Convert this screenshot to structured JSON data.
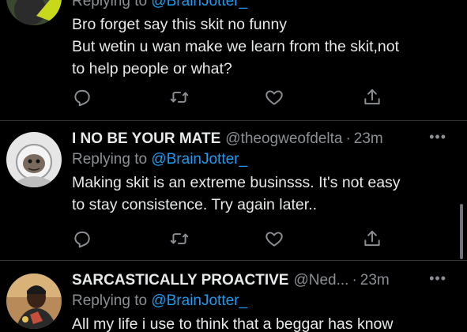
{
  "tweets": [
    {
      "replying_prefix": "Replying to",
      "replying_handle": "@BrainJotter_",
      "lines": [
        "Bro forget say this skit no funny",
        "But wetin u wan make we learn from the skit,not",
        "to help people or what?"
      ]
    },
    {
      "name": "I NO BE YOUR MATE",
      "handle": "@theogweofdelta",
      "dot": "·",
      "time": "23m",
      "more": "•••",
      "replying_prefix": "Replying to",
      "replying_handle": "@BrainJotter_",
      "lines": [
        "Making skit is an extreme businsss. It's not easy",
        "to stay consistence. Try again later.."
      ]
    },
    {
      "name": "SARCASTICALLY PROACTIVE",
      "handle": "@Ned...",
      "dot": "·",
      "time": "23m",
      "more": "•••",
      "replying_prefix": "Replying to",
      "replying_handle": "@BrainJotter_",
      "lines": [
        "All my life i use to think that a beggar has know"
      ]
    }
  ],
  "icons": {
    "reply": "reply-icon",
    "retweet": "retweet-icon",
    "like": "like-icon",
    "share": "share-icon",
    "more": "more-icon"
  },
  "colors": {
    "background": "#000000",
    "text": "#e7e9ea",
    "secondary": "#8b8f94",
    "link": "#1d9bf0",
    "divider": "#2f3336"
  }
}
